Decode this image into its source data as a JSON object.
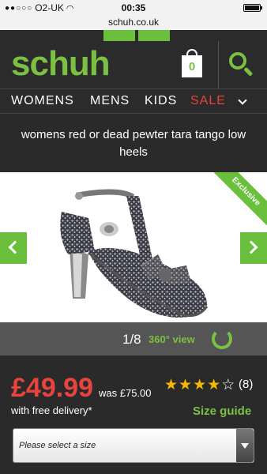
{
  "status_bar": {
    "carrier": "O2-UK",
    "time": "00:35"
  },
  "browser": {
    "url": "schuh.co.uk"
  },
  "header": {
    "logo": "schuh",
    "bag_count": "0"
  },
  "nav": {
    "items": [
      "WOMENS",
      "MENS",
      "KIDS",
      "SALE"
    ],
    "sale_color": "#e8433c"
  },
  "product": {
    "title": "womens red or dead pewter tara tango low heels",
    "badge": "Exclusive",
    "image_counter": "1/8",
    "view_360_label": "360° view",
    "price": "£49.99",
    "was_price": "was £75.00",
    "delivery": "with free delivery*",
    "rating": 4,
    "rating_max": 5,
    "review_count": "(8)",
    "size_guide_label": "Size guide",
    "size_select_placeholder": "Please select a size"
  },
  "colors": {
    "brand_green": "#7ac143",
    "price_red": "#e8433c",
    "star_gold": "#f5b800"
  }
}
